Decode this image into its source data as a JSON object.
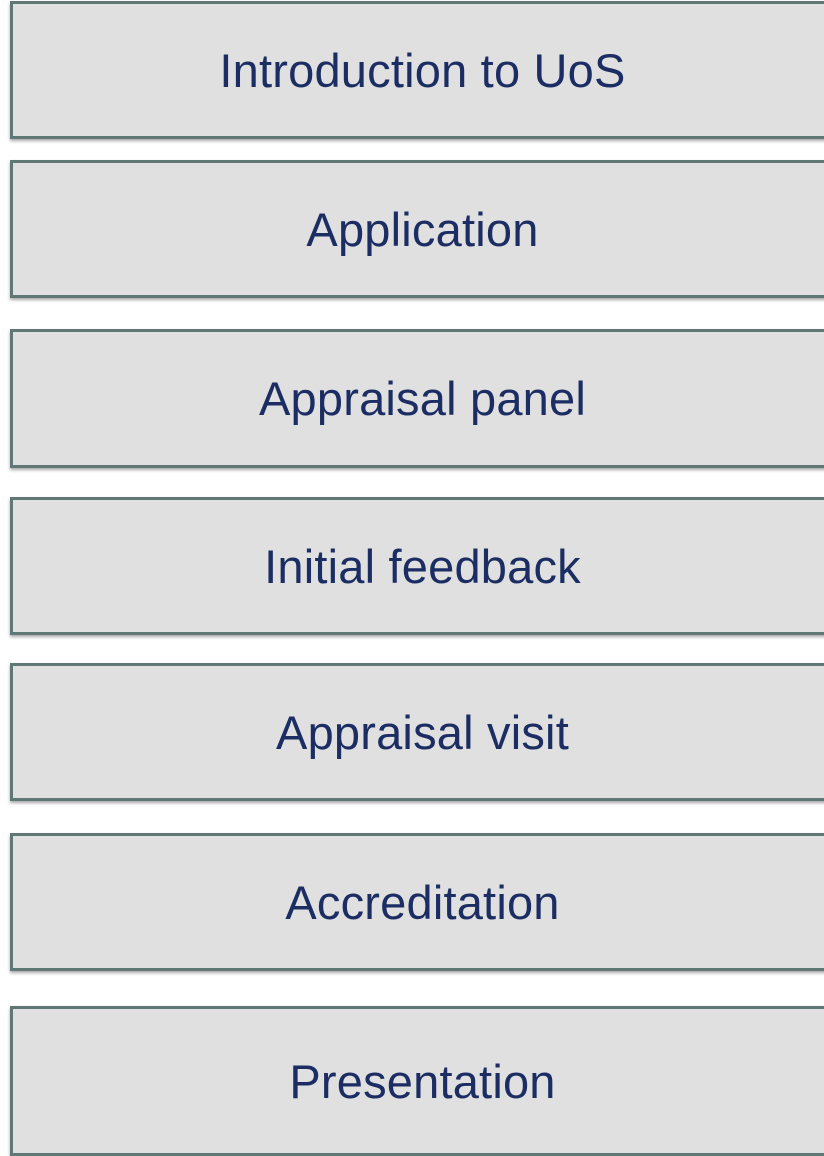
{
  "process_steps": [
    {
      "label": "Introduction to UoS"
    },
    {
      "label": "Application"
    },
    {
      "label": "Appraisal panel"
    },
    {
      "label": "Initial feedback"
    },
    {
      "label": "Appraisal visit"
    },
    {
      "label": "Accreditation"
    },
    {
      "label": "Presentation"
    }
  ],
  "colors": {
    "box_fill": "#e0e0e0",
    "box_border": "#5f7775",
    "text": "#1b2d63"
  }
}
